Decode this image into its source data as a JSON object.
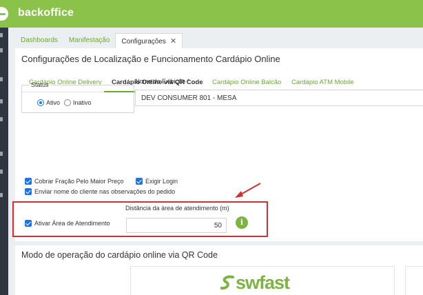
{
  "app": {
    "brand": "backoffice"
  },
  "tabs": [
    {
      "label": "Dashboards"
    },
    {
      "label": "Manifestação"
    },
    {
      "label": "Configurações",
      "close": "✕"
    }
  ],
  "panel": {
    "title": "Configurações de Localização e Funcionamento Cardápio Online",
    "subtabs": [
      {
        "label": "Cardápio Online Delivery"
      },
      {
        "label": "Cardápio Online via QR Code"
      },
      {
        "label": "Cardápio Online Balcão"
      },
      {
        "label": "Cardápio ATM Mobile"
      }
    ],
    "active_subtab": "Cardápio Online via QR Code"
  },
  "status": {
    "legend": "Status",
    "options": [
      {
        "label": "Ativo",
        "selected": true
      },
      {
        "label": "Inativo",
        "selected": false
      }
    ]
  },
  "display_name": {
    "label": "Nome de Exibição *",
    "value": "DEV CONSUMER 801 - MESA"
  },
  "checkboxes": {
    "cobrar": {
      "label": "Cobrar Fração Pelo Maior Preço",
      "checked": true
    },
    "exigir": {
      "label": "Exigir Login",
      "checked": true
    },
    "enviar": {
      "label": "Enviar nome do cliente nas observações do pedido",
      "checked": true
    },
    "ativar": {
      "label": "Ativar Área de Atendimento",
      "checked": true
    }
  },
  "distance": {
    "label": "Distância da área de atendimento (m)",
    "value": "50"
  },
  "info_icon": "info-icon",
  "mode": {
    "title": "Modo de operação do cardápio online via QR Code"
  },
  "logo_text": "swfast",
  "colors": {
    "brand_green": "#8bc34a",
    "accent_green": "#6aa832",
    "checkbox_blue": "#1a73e8",
    "highlight_red": "#d32f2f"
  }
}
